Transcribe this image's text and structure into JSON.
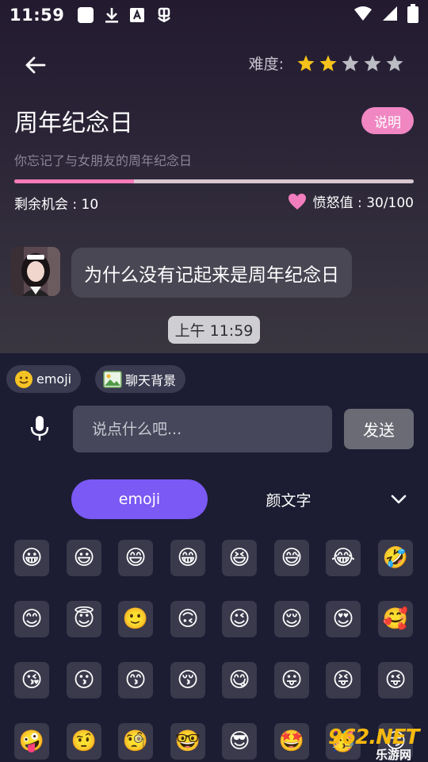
{
  "status_bar": {
    "time": "11:59",
    "icons": [
      "notification-square-icon",
      "download-icon",
      "a-box-icon",
      "bug-icon",
      "wifi-icon",
      "signal-icon",
      "battery-icon"
    ]
  },
  "header": {
    "difficulty_label": "难度:",
    "difficulty_level": 2,
    "difficulty_max": 5,
    "title": "周年纪念日",
    "explain_label": "说明",
    "subtitle": "你忘记了与女朋友的周年纪念日",
    "progress": 0.3,
    "chances_text": "剩余机会 : 10",
    "anger_text": "愤怒值 : 30/100"
  },
  "chat": {
    "message": "为什么没有记起来是周年纪念日",
    "timestamp": "上午 11:59"
  },
  "toolbar": {
    "emoji_chip": "emoji",
    "background_chip": "聊天背景"
  },
  "composer": {
    "placeholder": "说点什么吧...",
    "send_label": "发送"
  },
  "tabs": {
    "emoji": "emoji",
    "kaomoji": "颜文字"
  },
  "emojis": [
    "😀",
    "😃",
    "😄",
    "😁",
    "😆",
    "😅",
    "😂",
    "🤣",
    "😊",
    "😇",
    "🙂",
    "🙃",
    "😉",
    "😌",
    "😍",
    "🥰",
    "😘",
    "😗",
    "😙",
    "😚",
    "😋",
    "😛",
    "😝",
    "😜",
    "🤪",
    "🤨",
    "🧐",
    "🤓",
    "😎",
    "🤩",
    "🥳",
    "😏"
  ],
  "watermark": {
    "main": "962.NET",
    "sub": "乐游网"
  },
  "colors": {
    "accent": "#7a59f4",
    "pink": "#f086c2",
    "star": "#f4c21b",
    "star_off": "#bcbcc4"
  }
}
